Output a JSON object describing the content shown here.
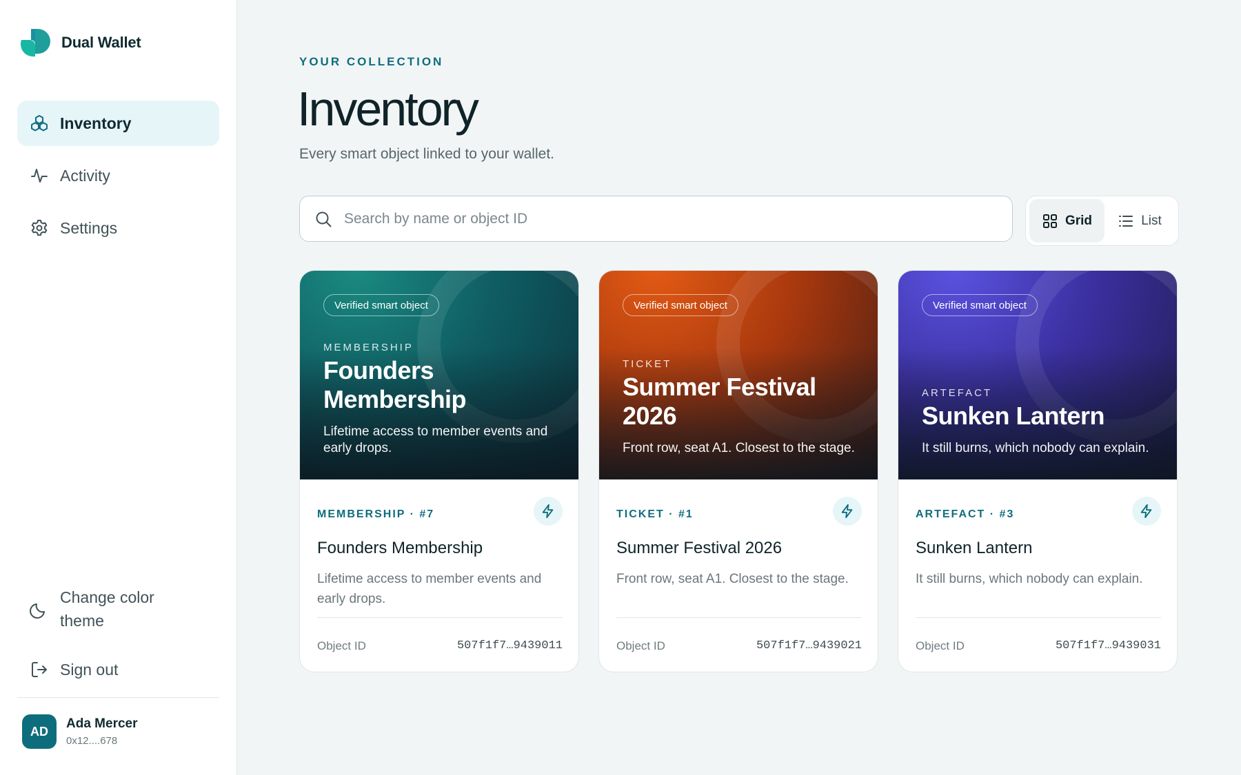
{
  "brand": {
    "name": "Dual Wallet",
    "icon": "dual-wallet-logo"
  },
  "nav": [
    {
      "label": "Inventory",
      "icon": "cubes-icon",
      "active": true
    },
    {
      "label": "Activity",
      "icon": "activity-icon",
      "active": false
    },
    {
      "label": "Settings",
      "icon": "gear-icon",
      "active": false
    }
  ],
  "bottom_nav": {
    "theme_label": "Change color theme",
    "theme_icon": "moon-icon",
    "signout_label": "Sign out",
    "signout_icon": "sign-out-icon"
  },
  "user": {
    "initials": "AD",
    "name": "Ada Mercer",
    "address": "0x12....678"
  },
  "header": {
    "eyebrow": "YOUR COLLECTION",
    "title": "Inventory",
    "subtitle": "Every smart object linked to your wallet."
  },
  "search": {
    "placeholder": "Search by name or object ID",
    "value": ""
  },
  "view_toggle": {
    "options": [
      {
        "label": "Grid",
        "icon": "grid-icon",
        "active": true
      },
      {
        "label": "List",
        "icon": "list-icon",
        "active": false
      }
    ]
  },
  "colors": {
    "accent": "#0e6d7d",
    "accent_soft": "#e6f5f8",
    "background": "#f2f5f6"
  },
  "cards": [
    {
      "theme": "teal",
      "badge": "Verified smart object",
      "kicker": "MEMBERSHIP",
      "hero_title": "Founders Membership",
      "hero_desc": "Lifetime access to member events and early drops.",
      "meta": "MEMBERSHIP · #7",
      "title": "Founders Membership",
      "desc": "Lifetime access to member events and early drops.",
      "id_label": "Object ID",
      "id_value": "507f1f7…9439011"
    },
    {
      "theme": "orange",
      "badge": "Verified smart object",
      "kicker": "TICKET",
      "hero_title": "Summer Festival 2026",
      "hero_desc": "Front row, seat A1. Closest to the stage.",
      "meta": "TICKET · #1",
      "title": "Summer Festival 2026",
      "desc": "Front row, seat A1. Closest to the stage.",
      "id_label": "Object ID",
      "id_value": "507f1f7…9439021"
    },
    {
      "theme": "purple",
      "badge": "Verified smart object",
      "kicker": "ARTEFACT",
      "hero_title": "Sunken Lantern",
      "hero_desc": "It still burns, which nobody can explain.",
      "meta": "ARTEFACT · #3",
      "title": "Sunken Lantern",
      "desc": "It still burns, which nobody can explain.",
      "id_label": "Object ID",
      "id_value": "507f1f7…9439031"
    }
  ]
}
